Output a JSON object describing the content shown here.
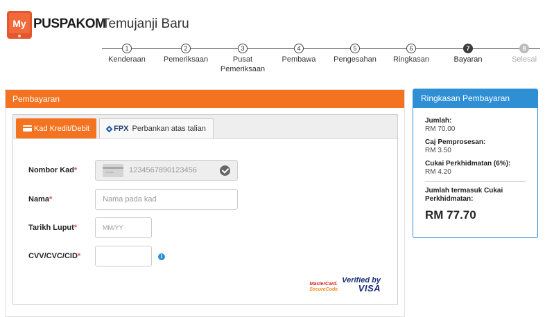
{
  "header": {
    "logo_prefix": "My",
    "logo_name": "PUSPAKOM",
    "page_title": "Temujanji Baru"
  },
  "stepper": {
    "steps": [
      {
        "number": "1",
        "label": "Kenderaan",
        "state": "done"
      },
      {
        "number": "2",
        "label": "Pemeriksaan",
        "state": "done"
      },
      {
        "number": "3",
        "label_line1": "Pusat",
        "label_line2": "Pemeriksaan",
        "state": "done"
      },
      {
        "number": "4",
        "label": "Pembawa",
        "state": "done"
      },
      {
        "number": "5",
        "label": "Pengesahan",
        "state": "done"
      },
      {
        "number": "6",
        "label": "Ringkasan",
        "state": "done"
      },
      {
        "number": "7",
        "label": "Bayaran",
        "state": "active"
      },
      {
        "number": "8",
        "label": "Selesai",
        "state": "future"
      }
    ]
  },
  "payment": {
    "title": "Pembayaran",
    "tabs": {
      "card_label": "Kad Kredit/Debit",
      "fpx_logo": "FPX",
      "fpx_label": "Perbankan atas talian"
    },
    "fields": {
      "card_number": {
        "label": "Nombor Kad",
        "required_mark": "*",
        "placeholder": "1234567890123456"
      },
      "name": {
        "label": "Nama",
        "required_mark": "*",
        "placeholder": "Nama pada kad"
      },
      "expiry": {
        "label": "Tarikh Luput",
        "required_mark": "*",
        "placeholder": "MM/YY"
      },
      "cvv": {
        "label": "CVV/CVC/CID",
        "required_mark": "*",
        "placeholder": ""
      }
    },
    "info_icon_glyph": "i",
    "badges": {
      "mastercard_line1": "MasterCard.",
      "mastercard_line2": "SecureCode",
      "visa_line1": "Verified by",
      "visa_line2": "VISA"
    }
  },
  "summary": {
    "title": "Ringkasan Pembayaran",
    "amount_label": "Jumlah:",
    "amount_value": "RM 70.00",
    "processing_label": "Caj Pemprosesan:",
    "processing_value": "RM 3.50",
    "tax_label": "Cukai Perkhidmatan (6%):",
    "tax_value": "RM 4.20",
    "total_label": "Jumlah termasuk Cukai Perkhidmatan:",
    "total_value": "RM 77.70"
  },
  "colors": {
    "accent_orange": "#f47321",
    "accent_blue": "#2f8fd5"
  }
}
